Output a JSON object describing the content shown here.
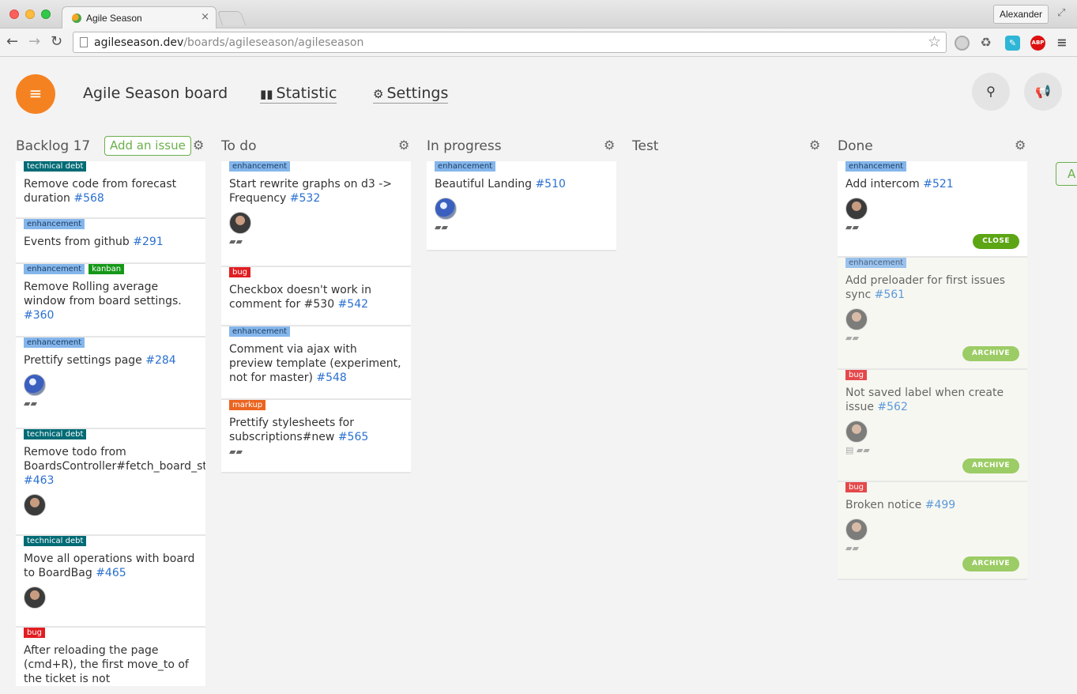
{
  "browser": {
    "tab_title": "Agile Season",
    "tab_close": "×",
    "profile_name": "Alexander",
    "url_host": "agileseason.dev",
    "url_path": "/boards/agileseason/agileseason"
  },
  "header": {
    "menu_icon": "≡",
    "board_title": "Agile Season board",
    "statistic_label": "Statistic",
    "settings_label": "Settings"
  },
  "columns": {
    "backlog": {
      "title": "Backlog 17",
      "add_label": "Add an issue"
    },
    "todo": {
      "title": "To do"
    },
    "inprogress": {
      "title": "In progress"
    },
    "test": {
      "title": "Test"
    },
    "done": {
      "title": "Done"
    },
    "add_column_label": "A"
  },
  "cards": {
    "b1": {
      "label1": "technical debt",
      "title": "Remove code from forecast duration",
      "num": "#568"
    },
    "b2": {
      "label1": "enhancement",
      "title": "Events from github",
      "num": "#291"
    },
    "b3": {
      "label1": "enhancement",
      "label2": "kanban",
      "title": "Remove Rolling average window from board settings.",
      "num": "#360"
    },
    "b4": {
      "label1": "enhancement",
      "title": "Prettify settings page",
      "num": "#284"
    },
    "b5": {
      "label1": "technical debt",
      "title": "Remove todo from BoardsController#fetch_board_stats",
      "num": "#463"
    },
    "b6": {
      "label1": "technical debt",
      "title": "Move all operations with board to BoardBag",
      "num": "#465"
    },
    "b7": {
      "label1": "bug",
      "title": "After reloading the page (cmd+R), the first move_to of the ticket is not",
      "num": ""
    },
    "t1": {
      "label1": "enhancement",
      "title": "Start rewrite graphs on d3 -> Frequency",
      "num": "#532"
    },
    "t2": {
      "label1": "bug",
      "title": "Checkbox doesn't work in comment for #530",
      "num": "#542"
    },
    "t3": {
      "label1": "enhancement",
      "title": "Comment via ajax with preview template (experiment, not for master)",
      "num": "#548"
    },
    "t4": {
      "label1": "markup",
      "title": "Prettify stylesheets for subscriptions#new",
      "num": "#565"
    },
    "p1": {
      "label1": "enhancement",
      "title": "Beautiful Landing",
      "num": "#510"
    },
    "d1": {
      "label1": "enhancement",
      "title": "Add intercom",
      "num": "#521",
      "button": "CLOSE"
    },
    "d2": {
      "label1": "enhancement",
      "title": "Add preloader for first issues sync",
      "num": "#561",
      "button": "ARCHIVE"
    },
    "d3": {
      "label1": "bug",
      "title": "Not saved label when create issue",
      "num": "#562",
      "button": "ARCHIVE"
    },
    "d4": {
      "label1": "bug",
      "title": "Broken notice",
      "num": "#499",
      "button": "ARCHIVE"
    }
  }
}
